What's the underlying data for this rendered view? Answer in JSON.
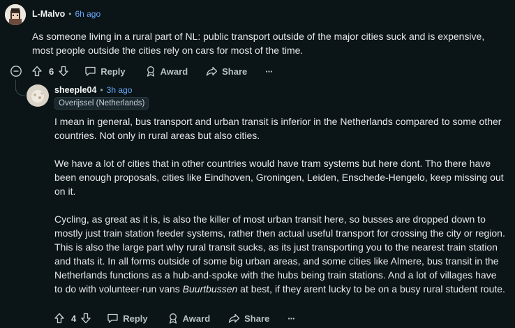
{
  "comment1": {
    "username": "L-Malvo",
    "separator": "•",
    "time": "6h ago",
    "text": "As someone living in a rural part of NL: public transport outside of the major cities suck and is expensive, most people outside the cities rely on cars for most of the time.",
    "votes": "6",
    "reply_label": "Reply",
    "award_label": "Award",
    "share_label": "Share",
    "more_label": "···"
  },
  "comment2": {
    "username": "sheeple04",
    "separator": "•",
    "time": "3h ago",
    "flair": "Overijssel (Netherlands)",
    "paragraphs": [
      "I mean in general, bus transport and urban transit is inferior in the Netherlands compared to some other countries. Not only in rural areas but also cities.",
      "We have a lot of cities that in other countries would have tram systems but here dont. Tho there have been enough proposals, cities like Eindhoven, Groningen, Leiden, Enschede-Hengelo, keep missing out on it."
    ],
    "p3_before": "Cycling, as great as it is, is also the killer of most urban transit here, so busses are dropped down to mostly just train station feeder systems, rather then actual useful transport for crossing the city or region. This is also the large part why rural transit sucks, as its just transporting you to the nearest train station and thats it. In all forms outside of some big urban areas, and some cities like Almere, bus transit in the Netherlands functions as a hub-and-spoke with the hubs being train stations. And a lot of villages have to do with volunteer-run vans ",
    "p3_italic": "Buurtbussen",
    "p3_after": " at best, if they arent lucky to be on a busy rural student route.",
    "votes": "4",
    "reply_label": "Reply",
    "award_label": "Award",
    "share_label": "Share",
    "more_label": "···"
  },
  "icons": [
    "collapse-icon",
    "upvote-icon",
    "downvote-icon",
    "reply-icon",
    "award-icon",
    "share-icon",
    "more-icon"
  ],
  "colors": {
    "background": "#0b1416",
    "time": "#6aa7ff",
    "text": "#e6e8ea",
    "muted": "#b7c0c5"
  }
}
